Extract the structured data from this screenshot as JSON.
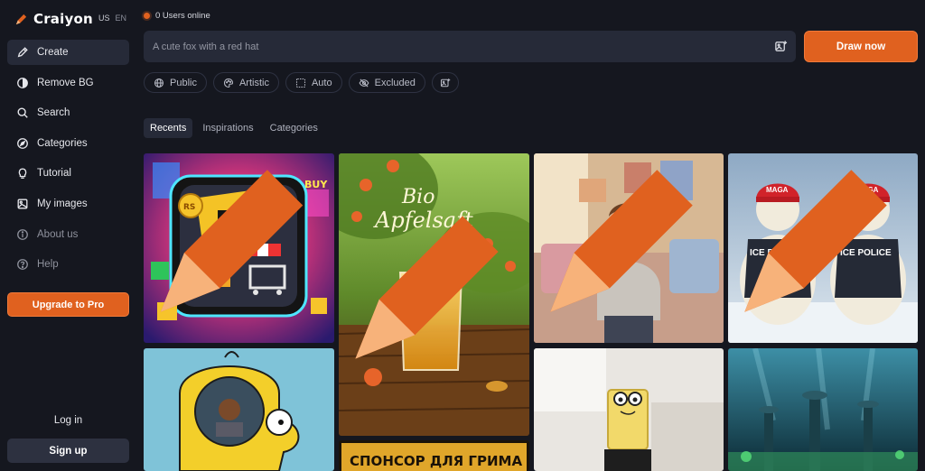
{
  "brand": {
    "name": "Craiyon",
    "locale_country": "US",
    "locale_lang": "EN"
  },
  "sidebar": {
    "items": [
      {
        "label": "Create",
        "icon": "pencil-icon"
      },
      {
        "label": "Remove BG",
        "icon": "contrast-icon"
      },
      {
        "label": "Search",
        "icon": "search-icon"
      },
      {
        "label": "Categories",
        "icon": "compass-icon"
      },
      {
        "label": "Tutorial",
        "icon": "lightbulb-icon"
      },
      {
        "label": "My images",
        "icon": "image-icon"
      },
      {
        "label": "About us",
        "icon": "info-icon"
      },
      {
        "label": "Help",
        "icon": "question-icon"
      }
    ],
    "upgrade_label": "Upgrade to Pro",
    "login_label": "Log in",
    "signup_label": "Sign up"
  },
  "status": {
    "text": "0 Users online"
  },
  "prompt": {
    "placeholder": "A cute fox with a red hat",
    "value": ""
  },
  "draw_button": {
    "label": "Draw now"
  },
  "options": [
    {
      "label": "Public",
      "icon": "globe-icon"
    },
    {
      "label": "Artistic",
      "icon": "palette-icon"
    },
    {
      "label": "Auto",
      "icon": "aspect-ratio-icon"
    },
    {
      "label": "Excluded",
      "icon": "eye-off-icon"
    }
  ],
  "tabs": [
    {
      "label": "Recents",
      "active": true
    },
    {
      "label": "Inspirations",
      "active": false
    },
    {
      "label": "Categories",
      "active": false
    }
  ],
  "gallery": {
    "tile_texts": {
      "apfelsaft_line1": "Bio",
      "apfelsaft_line2": "Apfelsaft",
      "roblox_letter": "R",
      "roblox_buy": "BUY",
      "roblox_coin": "RS",
      "bear_badge": "ICE POLICE",
      "bear_cap": "MAGA",
      "bottom_banner": "СПОНСОР ДЛЯ ГРИМА"
    }
  },
  "colors": {
    "accent": "#e0611f",
    "background": "#15171f",
    "surface": "#262a38"
  }
}
